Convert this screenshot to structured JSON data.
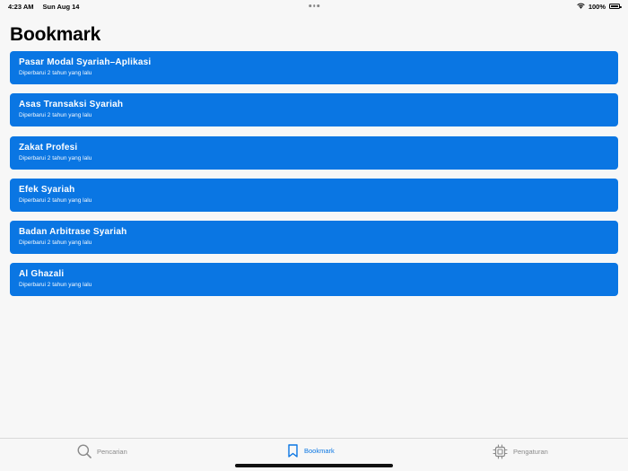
{
  "status_bar": {
    "time": "4:23 AM",
    "date": "Sun Aug 14",
    "battery": "100%"
  },
  "page": {
    "title": "Bookmark"
  },
  "bookmarks": [
    {
      "title": "Pasar Modal Syariah–Aplikasi",
      "subtitle": "Diperbarui 2 tahun yang lalu"
    },
    {
      "title": "Asas Transaksi Syariah",
      "subtitle": "Diperbarui 2 tahun yang lalu"
    },
    {
      "title": "Zakat Profesi",
      "subtitle": "Diperbarui 2 tahun yang lalu"
    },
    {
      "title": "Efek Syariah",
      "subtitle": "Diperbarui 2 tahun yang lalu"
    },
    {
      "title": "Badan Arbitrase Syariah",
      "subtitle": "Diperbarui 2 tahun yang lalu"
    },
    {
      "title": "Al Ghazali",
      "subtitle": "Diperbarui 2 tahun yang lalu"
    }
  ],
  "tab_bar": {
    "tabs": [
      {
        "label": "Pencarian",
        "icon": "search-icon",
        "active": false
      },
      {
        "label": "Bookmark",
        "icon": "bookmark-icon",
        "active": true
      },
      {
        "label": "Pengaturan",
        "icon": "cpu-icon",
        "active": false
      }
    ]
  },
  "colors": {
    "accent": "#0a76e3",
    "inactive": "#8a8a8a",
    "background": "#f7f7f7"
  }
}
